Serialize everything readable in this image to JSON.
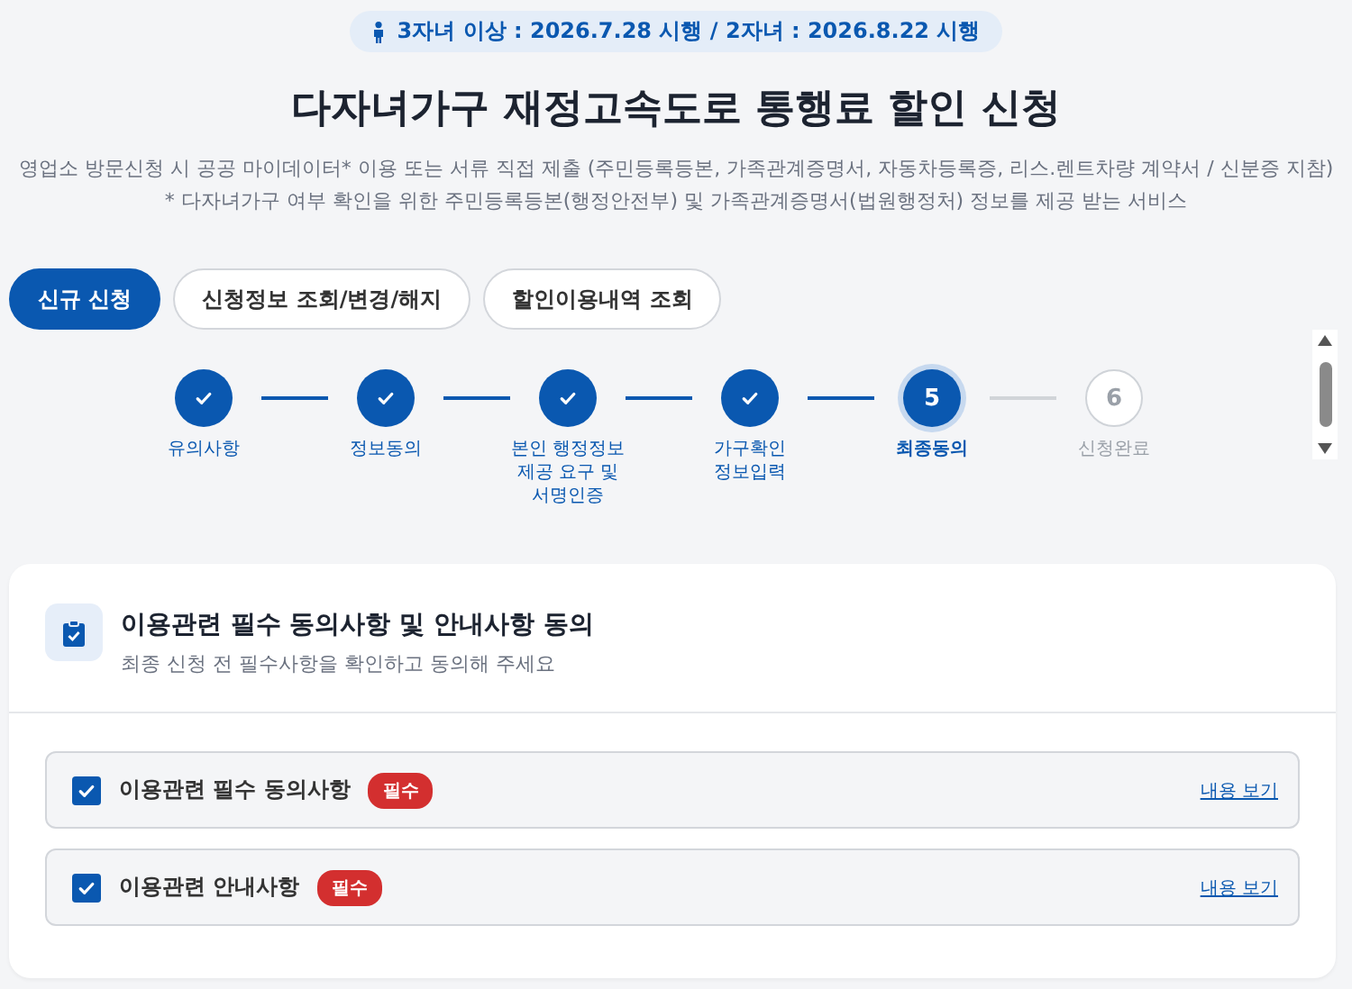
{
  "banner": {
    "text": "3자녀 이상 : 2026.7.28 시행 / 2자녀 : 2026.8.22 시행"
  },
  "title": "다자녀가구 재정고속도로 통행료 할인 신청",
  "descriptions": [
    "영업소 방문신청 시 공공 마이데이터* 이용 또는 서류 직접 제출 (주민등록등본, 가족관계증명서, 자동차등록증, 리스.렌트차량 계약서 / 신분증 지참)",
    "* 다자녀가구 여부 확인을 위한 주민등록등본(행정안전부) 및 가족관계증명서(법원행정처) 정보를 제공 받는 서비스"
  ],
  "tabs": [
    {
      "label": "신규 신청",
      "selected": true
    },
    {
      "label": "신청정보 조회/변경/해지",
      "selected": false
    },
    {
      "label": "할인이용내역 조회",
      "selected": false
    }
  ],
  "steps": [
    {
      "label": "유의사항",
      "done": true,
      "current": false
    },
    {
      "label": "정보동의",
      "done": true,
      "current": false
    },
    {
      "label": "본인 행정정보\n제공 요구 및\n서명인증",
      "done": true,
      "current": false
    },
    {
      "label": "가구확인\n정보입력",
      "done": true,
      "current": false
    },
    {
      "label": "최종동의",
      "done": false,
      "current": true,
      "number": "5"
    },
    {
      "label": "신청완료",
      "done": false,
      "current": false,
      "number": "6"
    }
  ],
  "card": {
    "title": "이용관련 필수 동의사항 및 안내사항 동의",
    "subtitle": "최종 신청 전 필수사항을 확인하고 동의해 주세요",
    "items": [
      {
        "label": "이용관련 필수 동의사항",
        "checked": true,
        "badge": "필수",
        "link": "내용 보기"
      },
      {
        "label": "이용관련 안내사항",
        "checked": true,
        "badge": "필수",
        "link": "내용 보기"
      }
    ]
  }
}
